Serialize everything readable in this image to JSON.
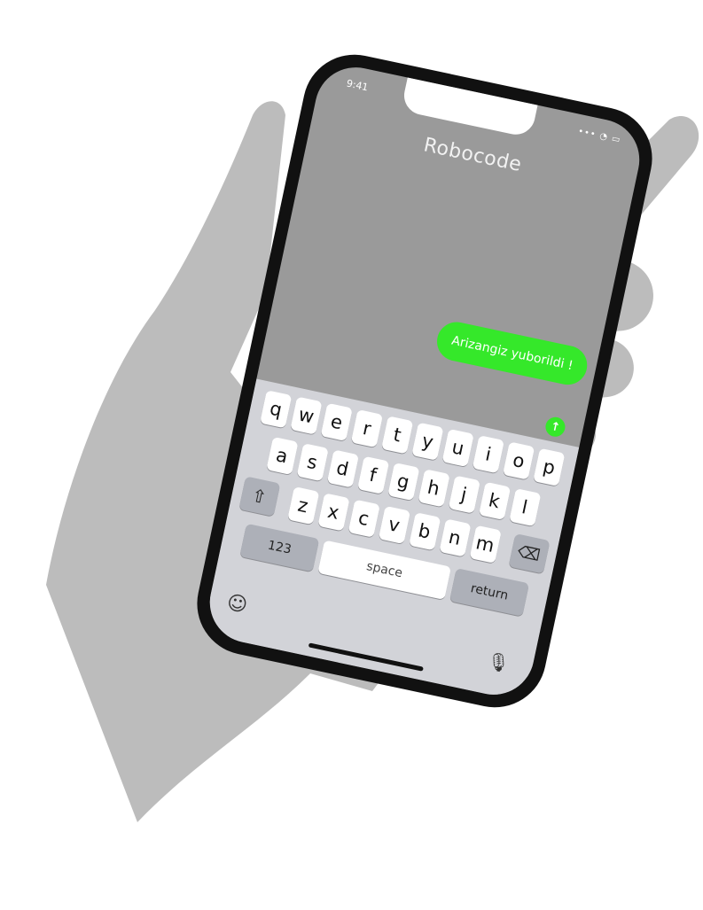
{
  "app": {
    "title": "Robocode",
    "time": "9:41",
    "status_icons": "••• ◔ ▭"
  },
  "message": {
    "text": "Arizangiz yuborildi !",
    "send_icon": "↑"
  },
  "keyboard": {
    "row1": [
      "q",
      "w",
      "e",
      "r",
      "t",
      "y",
      "u",
      "i",
      "o",
      "p"
    ],
    "row2": [
      "a",
      "s",
      "d",
      "f",
      "g",
      "h",
      "j",
      "k",
      "l"
    ],
    "row3": [
      "z",
      "x",
      "c",
      "v",
      "b",
      "n",
      "m"
    ],
    "shift_icon": "⇧",
    "backspace_icon": "⌫",
    "numbers_label": "123",
    "space_label": "space",
    "return_label": "return",
    "emoji_icon": "☺",
    "mic_icon": "🎙"
  },
  "colors": {
    "accent": "#35e82a",
    "screen": "#9a9a9a",
    "hand": "#bcbcbc",
    "keyboard": "#d2d3d8"
  }
}
